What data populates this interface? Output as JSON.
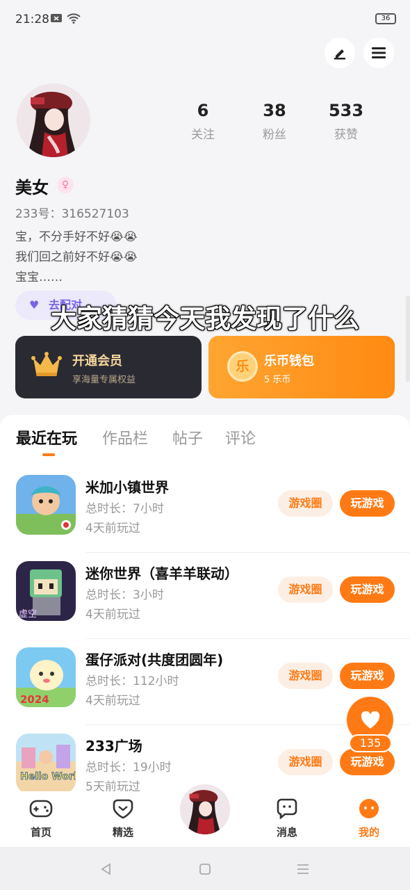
{
  "status_bar": {
    "time": "21:28",
    "battery": "36"
  },
  "profile": {
    "stats": [
      {
        "value": "6",
        "label": "关注"
      },
      {
        "value": "38",
        "label": "粉丝"
      },
      {
        "value": "533",
        "label": "获赞"
      }
    ],
    "username": "美女",
    "gender_symbol": "♀",
    "uid": "233号：316527103",
    "bio": [
      "宝，不分手好不好😭😭",
      "我们回之前好不好😭😭",
      "宝宝……"
    ],
    "pair_button": "去配对"
  },
  "overlay_caption": "大家猜猜今天我发现了什么",
  "cards": {
    "vip": {
      "title": "开通会员",
      "subtitle": "享海量专属权益"
    },
    "wallet": {
      "title": "乐币钱包",
      "subtitle": "5 乐币",
      "coin_char": "乐"
    }
  },
  "tabs": [
    "最近在玩",
    "作品栏",
    "帖子",
    "评论"
  ],
  "games": [
    {
      "name": "米加小镇世界",
      "duration": "总时长：7小时",
      "last_played": "4天前玩过",
      "circle_label": "游戏圈",
      "play_label": "玩游戏"
    },
    {
      "name": "迷你世界（喜羊羊联动）",
      "duration": "总时长：3小时",
      "last_played": "4天前玩过",
      "circle_label": "游戏圈",
      "play_label": "玩游戏",
      "icon_text": "虚空"
    },
    {
      "name": "蛋仔派对(共度团圆年)",
      "duration": "总时长：112小时",
      "last_played": "4天前玩过",
      "circle_label": "游戏圈",
      "play_label": "玩游戏",
      "icon_text": "2024"
    },
    {
      "name": "233广场",
      "duration": "总时长：19小时",
      "last_played": "5天前玩过",
      "circle_label": "游戏圈",
      "play_label": "玩游戏",
      "icon_text": "Hello World"
    }
  ],
  "like_count": "135",
  "bottom_nav": [
    {
      "label": "首页",
      "icon": "gamepad-icon"
    },
    {
      "label": "精选",
      "icon": "featured-icon"
    },
    {
      "label": "消息",
      "icon": "message-icon"
    },
    {
      "label": "我的",
      "icon": "profile-face-icon",
      "active": true
    }
  ],
  "colors": {
    "accent": "#ff7a14",
    "vip_bg": "#2a2a33",
    "pair_purple": "#7a62e8"
  }
}
